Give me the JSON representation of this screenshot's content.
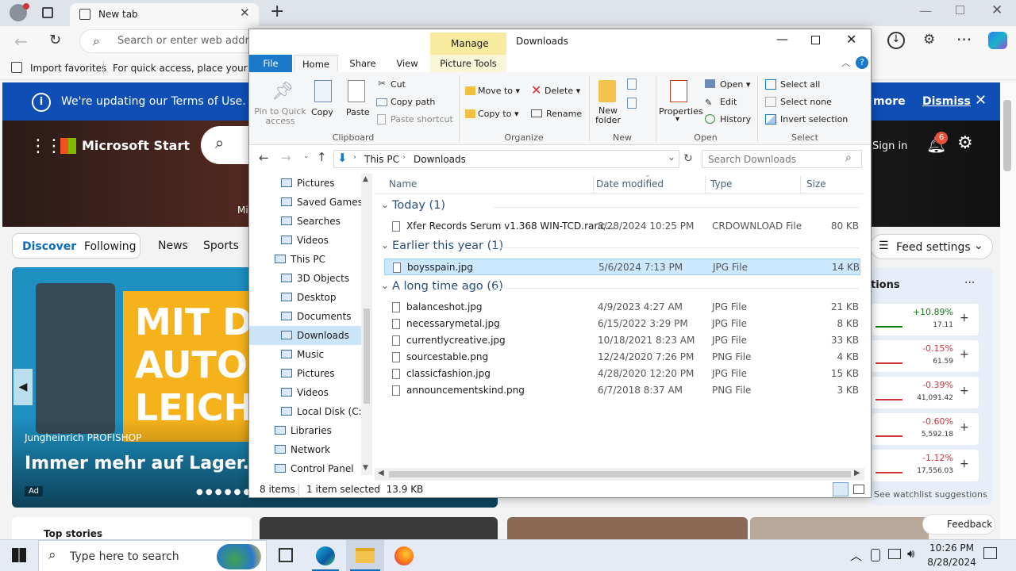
{
  "browser": {
    "tab_title": "New tab",
    "address_placeholder": "Search or enter web addres",
    "fav_import": "Import favorites",
    "fav_hint": "For quick access, place your favo"
  },
  "page": {
    "terms_text": "We're updating our Terms of Use.",
    "terms_more": "more",
    "terms_dismiss": "Dismiss",
    "brand": "Microsoft Start",
    "sign_in": "Sign in",
    "notif_count": "6",
    "hero_partial": "Mi",
    "nav_tabs": [
      "Discover",
      "Following",
      "News",
      "Sports"
    ],
    "feed_settings": "Feed settings",
    "ad": {
      "headline_lines": [
        "MIT DE",
        "AUTOM",
        "LEICH"
      ],
      "sponsor": "Jungheinrich PROFISHOP",
      "tagline": "Immer mehr auf Lager.",
      "ad_badge": "Ad"
    },
    "watch": {
      "title": "tions",
      "items": [
        {
          "change": "+10.89%",
          "value": "17.11",
          "color": "#107c10"
        },
        {
          "change": "-0.15%",
          "value": "61.59",
          "color": "#d13438"
        },
        {
          "change": "-0.39%",
          "value": "41,091.42",
          "color": "#d13438"
        },
        {
          "change": "-0.60%",
          "value": "5,592.18",
          "color": "#d13438"
        },
        {
          "change": "-1.12%",
          "value": "17,556.03",
          "color": "#d13438"
        }
      ],
      "suggestions": "See watchlist suggestions"
    },
    "top_stories": "Top stories",
    "feedback": "Feedback"
  },
  "explorer": {
    "title": "Downloads",
    "manage": "Manage",
    "ribbon_tabs": [
      "File",
      "Home",
      "Share",
      "View",
      "Picture Tools"
    ],
    "clipboard": {
      "pin": "Pin to Quick access",
      "copy": "Copy",
      "paste": "Paste",
      "cut": "Cut",
      "copy_path": "Copy path",
      "paste_shortcut": "Paste shortcut",
      "label": "Clipboard"
    },
    "organize": {
      "move_to": "Move to",
      "copy_to": "Copy to",
      "delete": "Delete",
      "rename": "Rename",
      "label": "Organize"
    },
    "new": {
      "new_folder": "New folder",
      "label": "New"
    },
    "open": {
      "properties": "Properties",
      "open": "Open",
      "edit": "Edit",
      "history": "History",
      "label": "Open"
    },
    "select": {
      "all": "Select all",
      "none": "Select none",
      "invert": "Invert selection",
      "label": "Select"
    },
    "breadcrumb": [
      "This PC",
      "Downloads"
    ],
    "search_placeholder": "Search Downloads",
    "nav": [
      {
        "label": "Pictures",
        "indent": 1
      },
      {
        "label": "Saved Games",
        "indent": 1
      },
      {
        "label": "Searches",
        "indent": 1
      },
      {
        "label": "Videos",
        "indent": 1
      },
      {
        "label": "This PC",
        "indent": 0
      },
      {
        "label": "3D Objects",
        "indent": 1
      },
      {
        "label": "Desktop",
        "indent": 1
      },
      {
        "label": "Documents",
        "indent": 1
      },
      {
        "label": "Downloads",
        "indent": 1,
        "selected": true
      },
      {
        "label": "Music",
        "indent": 1
      },
      {
        "label": "Pictures",
        "indent": 1
      },
      {
        "label": "Videos",
        "indent": 1
      },
      {
        "label": "Local Disk (C:)",
        "indent": 1
      },
      {
        "label": "Libraries",
        "indent": 0
      },
      {
        "label": "Network",
        "indent": 0
      },
      {
        "label": "Control Panel",
        "indent": 0
      }
    ],
    "columns": [
      "Name",
      "Date modified",
      "Type",
      "Size"
    ],
    "groups": [
      {
        "header": "Today (1)",
        "files": [
          {
            "name": "Xfer Records Serum v1.368 WIN-TCD.rar.c...",
            "date": "8/28/2024 10:25 PM",
            "type": "CRDOWNLOAD File",
            "size": "80 KB"
          }
        ]
      },
      {
        "header": "Earlier this year (1)",
        "files": [
          {
            "name": "boysspain.jpg",
            "date": "5/6/2024 7:13 PM",
            "type": "JPG File",
            "size": "14 KB",
            "selected": true
          }
        ]
      },
      {
        "header": "A long time ago (6)",
        "files": [
          {
            "name": "balanceshot.jpg",
            "date": "4/9/2023 4:27 AM",
            "type": "JPG File",
            "size": "21 KB"
          },
          {
            "name": "necessarymetal.jpg",
            "date": "6/15/2022 3:29 PM",
            "type": "JPG File",
            "size": "8 KB"
          },
          {
            "name": "currentlycreative.jpg",
            "date": "10/18/2021 8:23 AM",
            "type": "JPG File",
            "size": "33 KB"
          },
          {
            "name": "sourcestable.png",
            "date": "12/24/2020 7:26 PM",
            "type": "PNG File",
            "size": "4 KB"
          },
          {
            "name": "classicfashion.jpg",
            "date": "4/28/2020 12:20 PM",
            "type": "JPG File",
            "size": "15 KB"
          },
          {
            "name": "announcementskind.png",
            "date": "6/7/2018 8:37 AM",
            "type": "PNG File",
            "size": "3 KB"
          }
        ]
      }
    ],
    "status_items": "8 items",
    "status_selected": "1 item selected  13.9 KB"
  },
  "taskbar": {
    "search_placeholder": "Type here to search",
    "time": "10:26 PM",
    "date": "8/28/2024"
  }
}
